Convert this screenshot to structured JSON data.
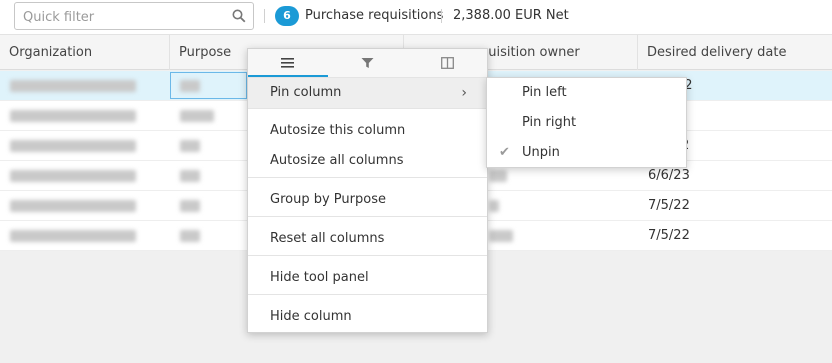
{
  "toolbar": {
    "filter_placeholder": "Quick filter",
    "badge_count": "6",
    "requisitions_label": "Purchase requisitions",
    "net_total": "2,388.00 EUR Net"
  },
  "columns": {
    "organization": "Organization",
    "purpose": "Purpose",
    "requisition_owner": "quisition owner",
    "desired_delivery_date": "Desired delivery date"
  },
  "rows": [
    {
      "date": "22"
    },
    {
      "date": ""
    },
    {
      "date": "2"
    },
    {
      "date": "6/6/23"
    },
    {
      "date": "7/5/22"
    },
    {
      "date": "7/5/22"
    }
  ],
  "column_menu": {
    "tabs": [
      "menu-icon",
      "filter-icon",
      "columns-icon"
    ],
    "pin_column": "Pin column",
    "autosize_this": "Autosize this column",
    "autosize_all": "Autosize all columns",
    "group_by": "Group by Purpose",
    "reset_columns": "Reset all columns",
    "hide_tool_panel": "Hide tool panel",
    "hide_column": "Hide column"
  },
  "pin_submenu": {
    "pin_left": "Pin left",
    "pin_right": "Pin right",
    "unpin": "Unpin",
    "checked": "Unpin"
  },
  "colors": {
    "accent": "#1b9ad6",
    "selected_row": "#dff3fb"
  }
}
